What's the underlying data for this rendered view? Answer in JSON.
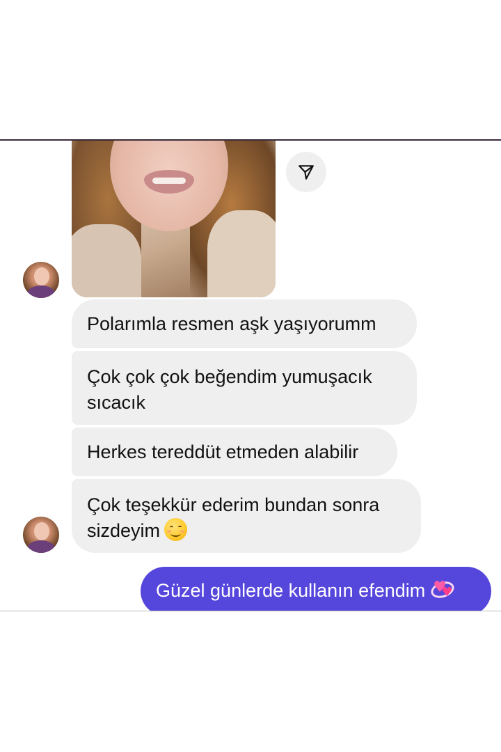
{
  "conversation": {
    "photo_message": {
      "image_desc": "shared-photo",
      "share_icon": "send-icon"
    },
    "incoming_messages": [
      {
        "text": "Polarımla resmen aşk yaşıyorumm"
      },
      {
        "text": "Çok çok çok beğendim yumuşacık sıcacık"
      },
      {
        "text": "Herkes tereddüt etmeden alabilir"
      },
      {
        "text": "Çok teşekkür ederim bundan sonra sizdeyim",
        "emoji": "smiling-face-icon"
      }
    ],
    "outgoing_message": {
      "text": "Güzel günlerde kullanın efendim",
      "emoji": "revolving-hearts-icon"
    }
  },
  "colors": {
    "incoming_bubble": "#efefef",
    "outgoing_bubble": "#5546dc",
    "text_dark": "#111111",
    "text_light": "#ffffff"
  }
}
